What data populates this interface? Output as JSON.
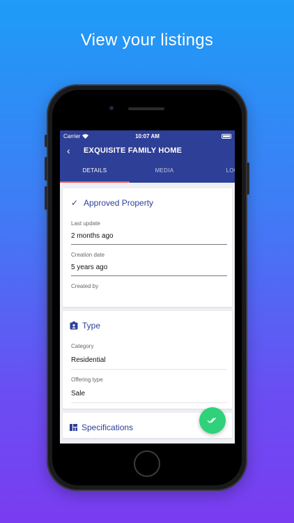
{
  "headline": "View your listings",
  "status_bar": {
    "carrier": "Carrier",
    "time": "10:07 AM"
  },
  "appbar": {
    "title": "EXQUISITE FAMILY HOME",
    "tabs": [
      {
        "label": "DETAILS",
        "active": true
      },
      {
        "label": "MEDIA",
        "active": false
      },
      {
        "label": "LOCA",
        "active": false
      }
    ]
  },
  "sections": {
    "status": {
      "title": "Approved Property",
      "icon": "checkmark-icon",
      "fields": [
        {
          "label": "Last update",
          "value": "2 months ago"
        },
        {
          "label": "Creation date",
          "value": "5 years ago"
        },
        {
          "label": "Created by",
          "value": ""
        }
      ]
    },
    "type": {
      "title": "Type",
      "icon": "badge-icon",
      "fields": [
        {
          "label": "Category",
          "value": "Residential"
        },
        {
          "label": "Offering type",
          "value": "Sale"
        }
      ]
    },
    "specifications": {
      "title": "Specifications",
      "icon": "grid-icon"
    }
  },
  "colors": {
    "primary": "#2e3f98",
    "tab_indicator": "#e85b5b",
    "fab": "#2fd17a",
    "background_top": "#1e9cf7",
    "background_bottom": "#7a3cf0"
  }
}
